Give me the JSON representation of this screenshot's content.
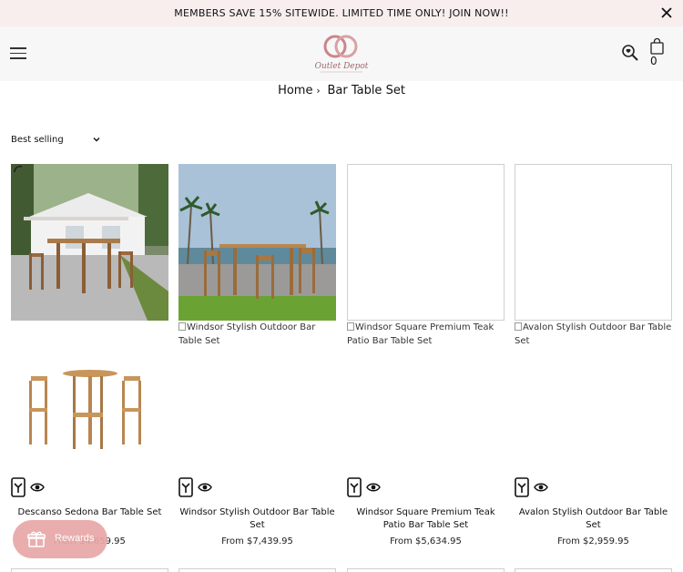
{
  "announcement": {
    "text": "MEMBERS SAVE 15% SITEWIDE. LIMITED TIME ONLY! JOIN NOW!!"
  },
  "header": {
    "logo_text": "Outlet Depot",
    "cart_count": "0"
  },
  "breadcrumb": {
    "home": "Home",
    "current": "Bar Table Set"
  },
  "sort": {
    "selected": "Best selling"
  },
  "products": [
    {
      "title": "Descanso Sedona Bar Table Set",
      "price": "From $4,659.95",
      "price_visible": "5",
      "image_alt": ""
    },
    {
      "title": "Windsor Stylish Outdoor Bar Table Set",
      "price": "From $7,439.95",
      "image_alt": "Windsor Stylish Outdoor Bar Table Set"
    },
    {
      "title": "Windsor Square Premium Teak Patio Bar Table Set",
      "price": "From $5,634.95",
      "image_alt": "Windsor Square Premium Teak Patio Bar Table Set"
    },
    {
      "title": "Avalon Stylish Outdoor Bar Table Set",
      "price": "From $2,959.95",
      "image_alt": "Avalon Stylish Outdoor Bar Table Set"
    }
  ],
  "rewards": {
    "label": "Rewards"
  },
  "colors": {
    "announcement_bg": "#f8eeee",
    "header_bg": "#f7f7f7",
    "rewards_bg": "#e9a7a7",
    "logo_accent": "#c9868a"
  }
}
